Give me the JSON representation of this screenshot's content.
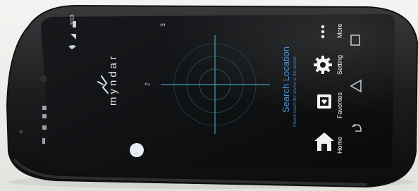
{
  "device_photo": {
    "status_bar": {
      "time": "3:03"
    },
    "app": {
      "brand": "myndar"
    },
    "screen": {
      "title": "Search Location",
      "hint": "Please touch the device to the sensor",
      "steps": [
        "1",
        "2",
        "3"
      ]
    },
    "nav_menu": [
      {
        "label": "Home",
        "icon": "home-icon"
      },
      {
        "label": "Favorites",
        "icon": "favorites-icon"
      },
      {
        "label": "Setting",
        "icon": "gear-icon"
      },
      {
        "label": "More",
        "icon": "more-icon"
      }
    ],
    "system_buttons": [
      "back-icon",
      "home-outline-icon",
      "recents-icon"
    ]
  }
}
